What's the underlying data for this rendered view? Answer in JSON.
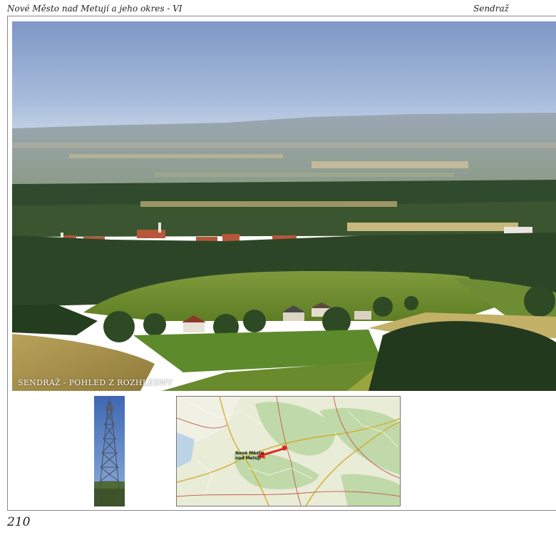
{
  "header": {
    "left": "Nové Město nad Metují a jeho okres - VI",
    "right": "Sendraž"
  },
  "photo": {
    "caption": "SENDRAŽ - POHLED Z ROZHLEDNY"
  },
  "map": {
    "town_label": "Nové Město nad Metují"
  },
  "page_number": "210"
}
